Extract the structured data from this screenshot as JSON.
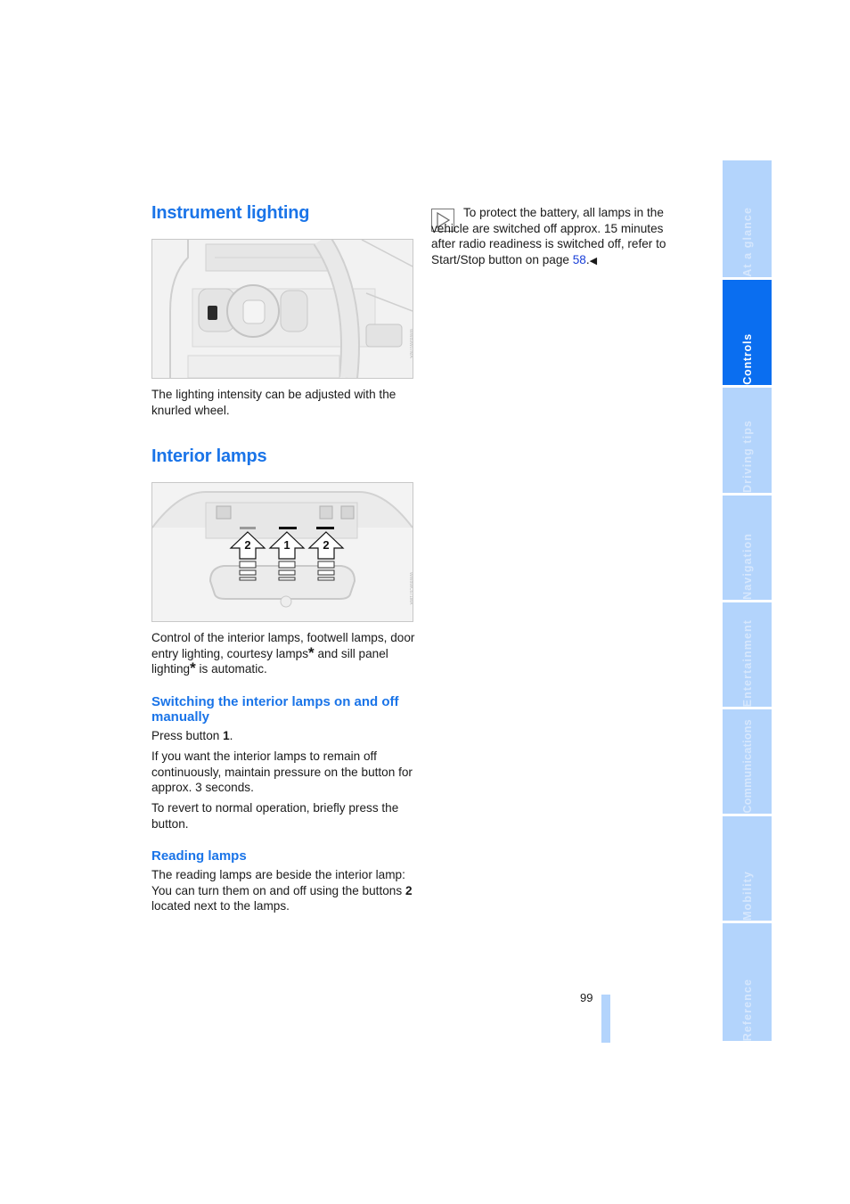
{
  "left_column": {
    "section1": {
      "title": "Instrument lighting",
      "figure_label": "Light switch with knurled wheel for instrument lighting",
      "body": "The lighting intensity can be adjusted with the knurled wheel."
    },
    "section2": {
      "title": "Interior lamps",
      "figure_label": "Roof console with interior lamp buttons",
      "figure_callouts": [
        "2",
        "1",
        "2"
      ],
      "intro": [
        "Control of the interior lamps, footwell lamps, door entry lighting, courtesy lamps",
        "*",
        " and sill panel lighting",
        "*",
        " is automatic."
      ],
      "sub1": {
        "title": "Switching the interior lamps on and off manually",
        "p1_pre": "Press button ",
        "p1_bold": "1",
        "p1_post": ".",
        "p2": "If you want the interior lamps to remain off continuously, maintain pressure on the button for approx. 3 seconds.",
        "p3": "To revert to normal operation, briefly press the button."
      },
      "sub2": {
        "title": "Reading lamps",
        "p1_pre": "The reading lamps are beside the interior lamp: You can turn them on and off using the buttons ",
        "p1_bold": "2",
        "p1_post": " located next to the lamps."
      }
    }
  },
  "right_column": {
    "note": {
      "icon": "note-triangle-icon",
      "text_pre": "To protect the battery, all lamps in the vehicle are switched off approx. 15 minutes after radio readiness is switched off, refer to Start/Stop button on page ",
      "link": "58",
      "text_post": ".",
      "end_marker": "◀"
    }
  },
  "page_number": "99",
  "side_tabs": [
    {
      "label": "At a glance",
      "active": false
    },
    {
      "label": "Controls",
      "active": true
    },
    {
      "label": "Driving tips",
      "active": false
    },
    {
      "label": "Navigation",
      "active": false
    },
    {
      "label": "Entertainment",
      "active": false
    },
    {
      "label": "Communications",
      "active": false
    },
    {
      "label": "Mobility",
      "active": false
    },
    {
      "label": "Reference",
      "active": false
    }
  ],
  "colors": {
    "heading": "#1a74e8",
    "tab_active": "#0a6ef0",
    "tab_inactive": "#b3d4fc",
    "link": "#1a3fd8"
  }
}
